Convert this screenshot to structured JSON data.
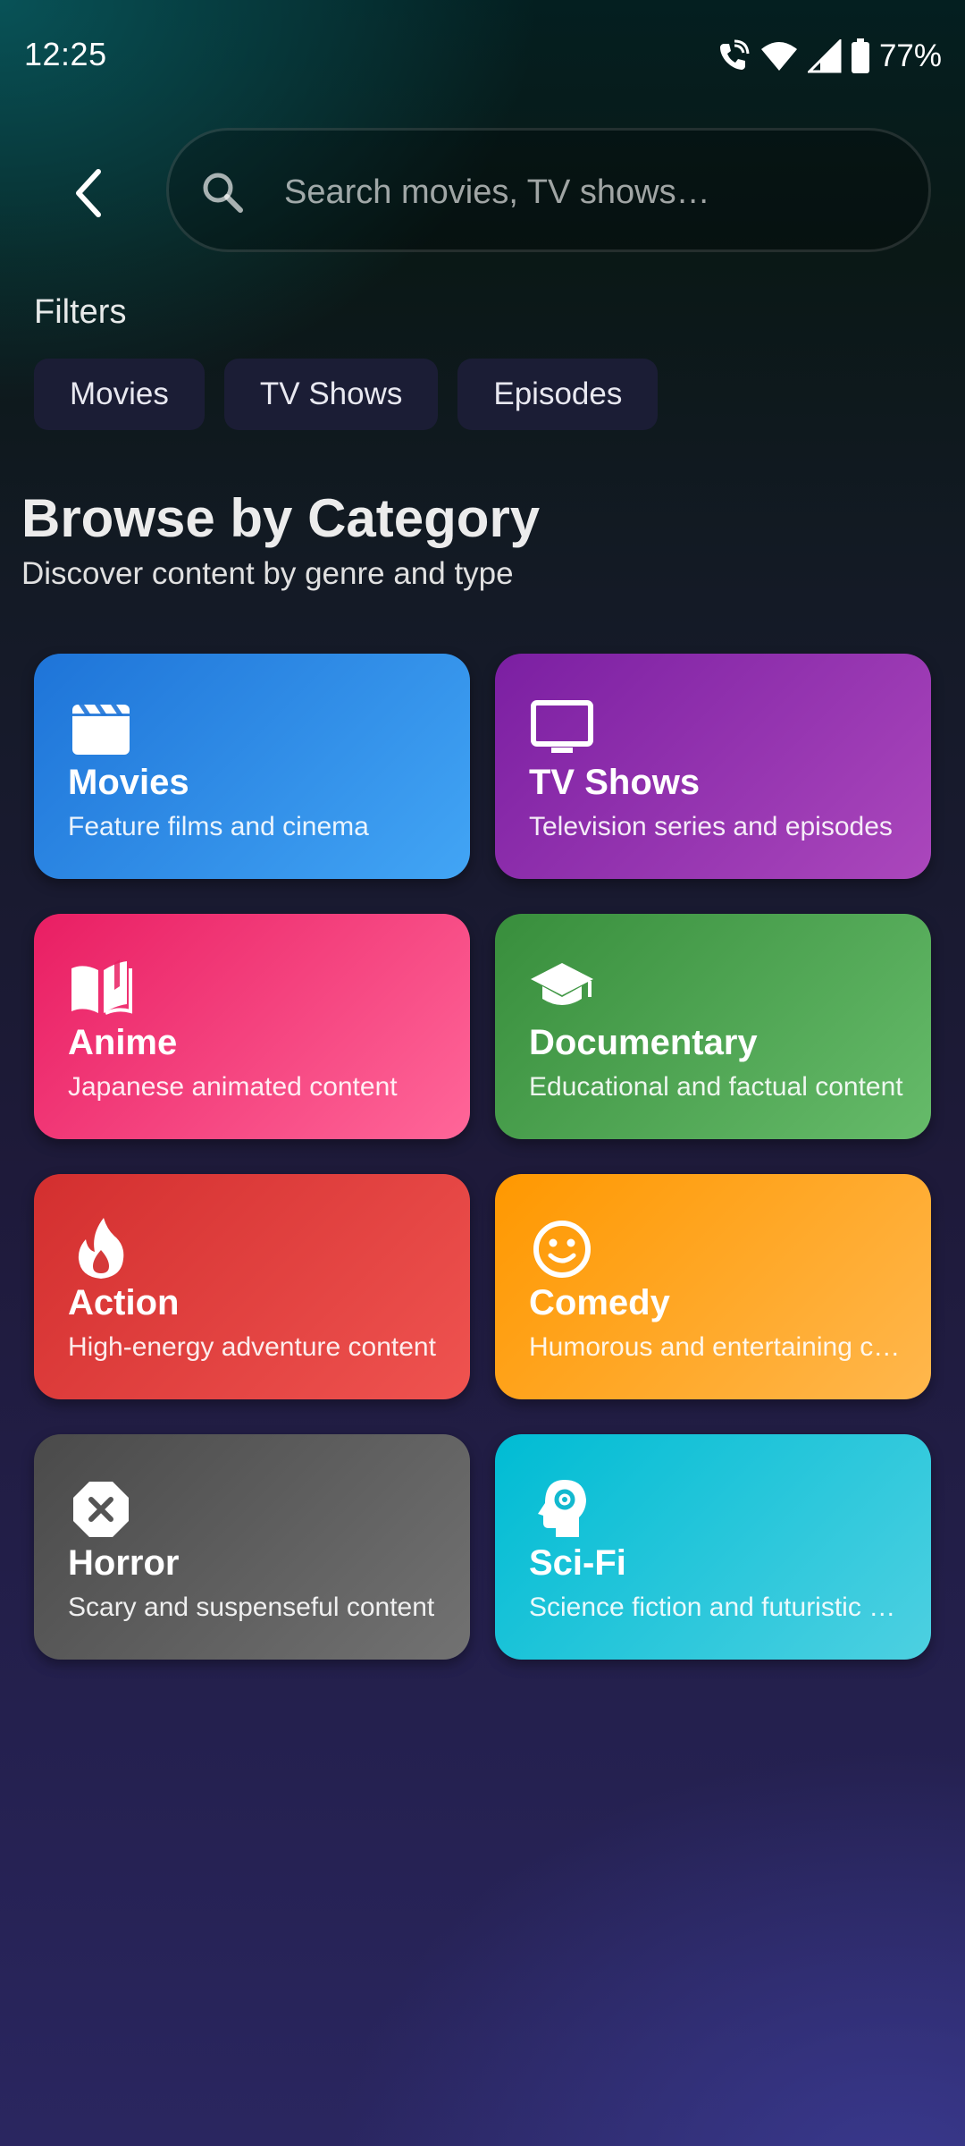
{
  "status_bar": {
    "time": "12:25",
    "battery": "77%",
    "icons": [
      "wifi-calling-icon",
      "wifi-icon",
      "cell-signal-icon",
      "battery-icon"
    ]
  },
  "search": {
    "placeholder": "Search movies, TV shows…",
    "value": ""
  },
  "filters": {
    "label": "Filters",
    "chips": [
      "Movies",
      "TV Shows",
      "Episodes"
    ]
  },
  "section": {
    "title": "Browse by Category",
    "subtitle": "Discover content by genre and type"
  },
  "categories": [
    {
      "title": "Movies",
      "description": "Feature films and cinema",
      "icon": "clapperboard-icon",
      "color_start": "#1e74d8",
      "color_end": "#42a5f5"
    },
    {
      "title": "TV Shows",
      "description": "Television series and episodes",
      "icon": "tv-icon",
      "color_start": "#7b1fa2",
      "color_end": "#ab47bc"
    },
    {
      "title": "Anime",
      "description": "Japanese animated content",
      "icon": "book-open-icon",
      "color_start": "#e91e63",
      "color_end": "#ff6699"
    },
    {
      "title": "Documentary",
      "description": "Educational and factual content",
      "icon": "graduation-cap-icon",
      "color_start": "#388e3c",
      "color_end": "#66bb6a"
    },
    {
      "title": "Action",
      "description": "High-energy adventure content",
      "icon": "flame-icon",
      "color_start": "#d32f2f",
      "color_end": "#ef5350"
    },
    {
      "title": "Comedy",
      "description": "Humorous and entertaining content",
      "icon": "smiley-icon",
      "color_start": "#ff9800",
      "color_end": "#ffb74d"
    },
    {
      "title": "Horror",
      "description": "Scary and suspenseful content",
      "icon": "octagon-x-icon",
      "color_start": "#4a4a4a",
      "color_end": "#727272"
    },
    {
      "title": "Sci-Fi",
      "description": "Science fiction and futuristic content",
      "icon": "head-gear-icon",
      "color_start": "#00bcd4",
      "color_end": "#4dd0e1"
    }
  ]
}
